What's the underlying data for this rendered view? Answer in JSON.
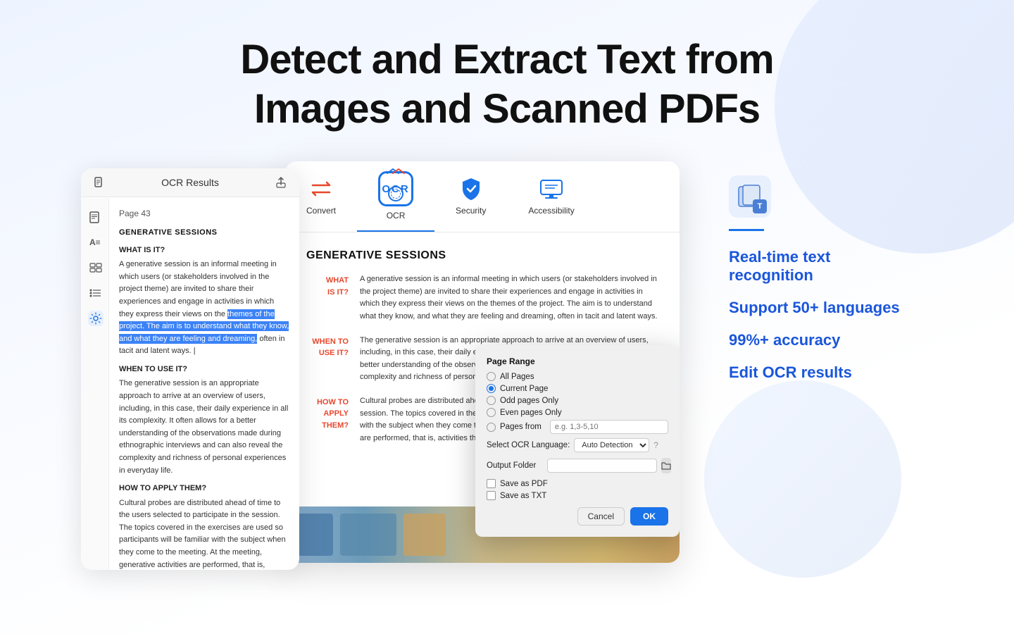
{
  "header": {
    "line1": "Detect and Extract Text from",
    "line2": "Images and Scanned PDFs"
  },
  "toolbar": {
    "items": [
      {
        "id": "convert",
        "label": "Convert",
        "icon": "arrows"
      },
      {
        "id": "ocr",
        "label": "OCR",
        "icon": "ocr",
        "active": true
      },
      {
        "id": "security",
        "label": "Security",
        "icon": "shield"
      },
      {
        "id": "accessibility",
        "label": "Accessibility",
        "icon": "monitor"
      }
    ]
  },
  "left_panel": {
    "title": "OCR Results",
    "page": "Page 43",
    "section1": "GENERATIVE SESSIONS",
    "subtitle1": "WHAT IS IT?",
    "text1": "A generative session is an informal meeting in which users (or stakeholders involved in the project theme) are invited to share their experiences and engage in activities in which they express their views on the themes of the project. The aim is to understand what they know, what they are feeling and dreaming, often in tacit and latent ways.",
    "subtitle2": "WHEN TO USE IT?",
    "text2": "The generative session is an appropriate approach to arrive at an overview of users, including, in this case, their daily experience in all its complexity. It often allows for a better understanding of the observations made during ethnographic interviews and can also reveal the complexity and richness of personal experiences in everyday life.",
    "subtitle3": "HOW TO APPLY THEM?",
    "text3": "Cultural probes are distributed ahead of time to the users selected to participate in the session. The topics covered in the exercises are used so participants will be familiar with the subject when they come to the meeting. At the meeting, generative activities are performed, that is, activities"
  },
  "pdf_content": {
    "title": "GENERATIVE SESSIONS",
    "rows": [
      {
        "label": "WHAT IS IT?",
        "text": "A generative session is an informal meeting in which users (or stakeholders involved in the project theme) are invited to share their experiences and engage in activities in which they express their views on the themes of the project. The aim is to understand what they know, and what they are feeling and dreaming, often in tacit and latent ways."
      },
      {
        "label": "WHEN TO USE IT?",
        "text": "The generative session is an appropriate approach to arrive at an overview of users, including, in this case, their daily experiences in all its complexity. It often allows for a better understanding of the observations made during ethnographic interviews and the complexity and richness of personal experiences in..."
      },
      {
        "label": "HOW TO APPLY THEM?",
        "text": "Cultural probes are distributed ahead of time to the users selected to participate in the session. The topics covered in the exercises are used so participants will be familiar with the subject when they come to the meeting. At the meeting, generative activities are performed, that is, activities that seek to construct and express exp..."
      }
    ]
  },
  "dialog": {
    "title": "Page Range",
    "options": [
      {
        "id": "all",
        "label": "All Pages",
        "selected": false
      },
      {
        "id": "current",
        "label": "Current Page",
        "selected": true
      },
      {
        "id": "odd",
        "label": "Odd pages Only",
        "selected": false
      },
      {
        "id": "even",
        "label": "Even pages Only",
        "selected": false
      },
      {
        "id": "pages_from",
        "label": "Pages from",
        "selected": false
      }
    ],
    "pages_from_placeholder": "e.g. 1,3-5,10",
    "ocr_language_label": "Select OCR Language:",
    "ocr_language_value": "Auto Detection",
    "output_folder_label": "Output Folder",
    "save_options": [
      {
        "id": "pdf",
        "label": "Save as PDF"
      },
      {
        "id": "txt",
        "label": "Save as TXT"
      }
    ],
    "cancel_label": "Cancel",
    "ok_label": "OK"
  },
  "features": {
    "items": [
      "Real-time text recognition",
      "Support 50+ languages",
      "99%+ accuracy",
      "Edit OCR results"
    ],
    "color": "#1a56db"
  }
}
